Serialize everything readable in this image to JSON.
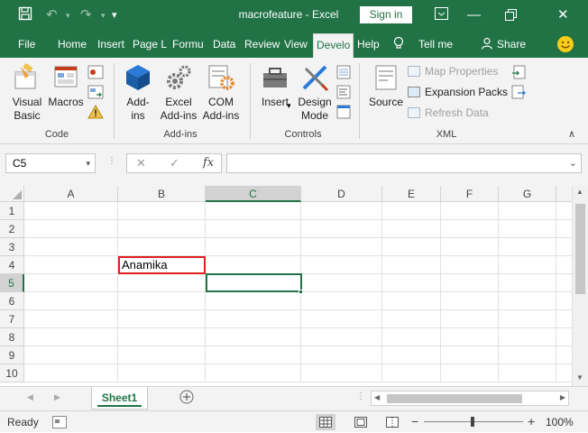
{
  "window": {
    "title": "macrofeature  -  Excel",
    "signin_label": "Sign in"
  },
  "tabs": [
    "File",
    "Home",
    "Insert",
    "Page L",
    "Formu",
    "Data",
    "Review",
    "View",
    "Develo",
    "Help"
  ],
  "tell_me": "Tell me",
  "share": "Share",
  "ribbon": {
    "code": {
      "label": "Code",
      "visual_basic": [
        "Visual",
        "Basic"
      ],
      "macros": "Macros"
    },
    "addins": {
      "label": "Add-ins",
      "addins_btn": [
        "Add-",
        "ins"
      ],
      "excel_addins": [
        "Excel",
        "Add-ins"
      ],
      "com_addins": [
        "COM",
        "Add-ins"
      ]
    },
    "controls": {
      "label": "Controls",
      "insert": "Insert",
      "design_mode": [
        "Design",
        "Mode"
      ]
    },
    "xml": {
      "label": "XML",
      "source": "Source",
      "map_properties": "Map Properties",
      "expansion_packs": "Expansion Packs",
      "refresh_data": "Refresh Data"
    }
  },
  "formula_bar": {
    "name_box": "C5",
    "fx": "fx",
    "formula": ""
  },
  "grid": {
    "columns": [
      "A",
      "B",
      "C",
      "D",
      "E",
      "F",
      "G"
    ],
    "selected_column": "C",
    "rows": [
      "1",
      "2",
      "3",
      "4",
      "5",
      "6",
      "7",
      "8",
      "9",
      "10"
    ],
    "selected_row": "5",
    "cells": {
      "B4": "Anamika"
    }
  },
  "sheets": {
    "active": "Sheet1"
  },
  "status": {
    "ready": "Ready",
    "zoom": "100%"
  },
  "colors": {
    "accent": "#217346",
    "highlight_box": "#e01f1f"
  }
}
